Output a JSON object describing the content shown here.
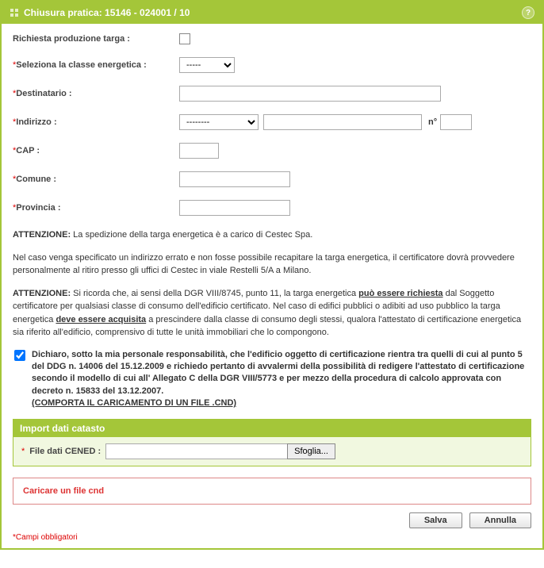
{
  "titlebar": {
    "title": "Chiusura pratica: 15146 - 024001 / 10"
  },
  "form": {
    "richiesta_label": "Richiesta produzione targa :",
    "classe_label": "Seleziona la classe energetica :",
    "classe_options": [
      "-----"
    ],
    "classe_value": "-----",
    "destinatario_label": "Destinatario :",
    "destinatario_value": "",
    "indirizzo_label": "Indirizzo :",
    "indirizzo_select_value": "--------",
    "indirizzo_value": "",
    "n_label": "n°",
    "n_value": "",
    "cap_label": "CAP :",
    "cap_value": "",
    "comune_label": "Comune :",
    "comune_value": "",
    "provincia_label": "Provincia :",
    "provincia_value": ""
  },
  "info": {
    "p1_bold": "ATTENZIONE:",
    "p1_text": " La spedizione della targa energetica è a carico di Cestec Spa.",
    "p2": "Nel caso venga specificato un indirizzo errato e non fosse possibile recapitare la targa energetica, il certificatore dovrà provvedere personalmente al ritiro presso gli uffici di Cestec in viale Restelli 5/A a Milano.",
    "p3_bold": "ATTENZIONE:",
    "p3_a": " Si ricorda che, ai sensi della DGR VIII/8745, punto 11, la targa energetica ",
    "p3_u1": "può essere richiesta",
    "p3_b": " dal Soggetto certificatore per qualsiasi classe di consumo dell'edificio certificato. Nel caso di edifici pubblici o adibiti ad uso pubblico la targa energetica ",
    "p3_u2": "deve essere acquisita",
    "p3_c": " a prescindere dalla classe di consumo degli stessi, qualora l'attestato di certificazione energetica sia riferito all'edificio, comprensivo di tutte le unità immobiliari che lo compongono."
  },
  "declaration": {
    "checked": true,
    "text_a": "Dichiaro, sotto la mia personale responsabilità, che l'edificio oggetto di certificazione rientra tra quelli di cui al punto 5 del DDG n. 14006 del 15.12.2009 e richiedo pertanto di avvalermi della possibilità di redigere l'attestato di certificazione secondo il modello di cui all' Allegato C della DGR VIII/5773 e per mezzo della procedura di calcolo approvata con decreto n. 15833 del 13.12.2007.",
    "text_u": "(COMPORTA IL CARICAMENTO DI UN FILE .CND)"
  },
  "import": {
    "header": "Import dati catasto",
    "label": "File dati CENED :",
    "browse_btn": "Sfoglia..."
  },
  "error": {
    "text": "Caricare un file cnd"
  },
  "buttons": {
    "save": "Salva",
    "cancel": "Annulla"
  },
  "footer": {
    "note": "Campi obbligatori"
  }
}
